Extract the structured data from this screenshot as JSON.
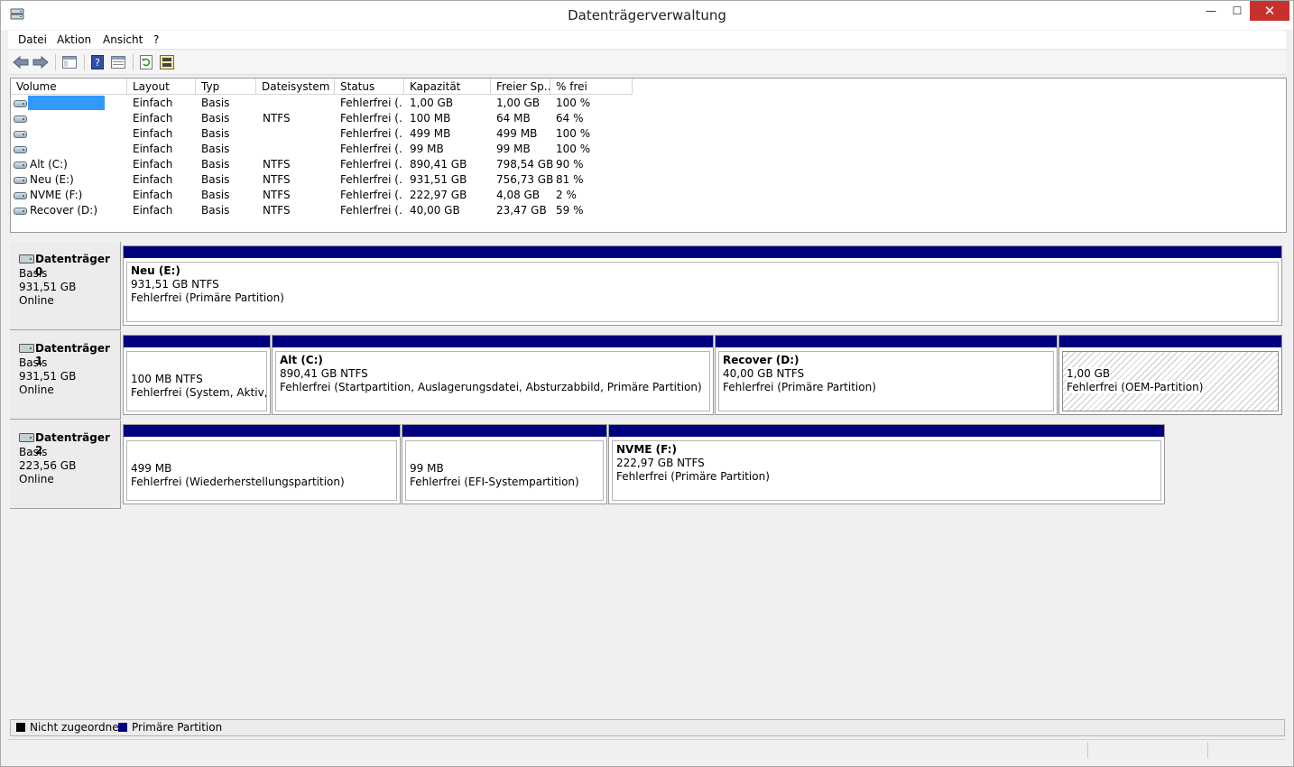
{
  "window": {
    "title": "Datenträgerverwaltung",
    "minimize": "—",
    "maximize": "☐",
    "close": "✕"
  },
  "menu": [
    "Datei",
    "Aktion",
    "Ansicht",
    "?"
  ],
  "toolbar": {
    "buttons": [
      "back-icon",
      "forward-icon",
      "console-tree-icon",
      "help-icon",
      "properties-icon",
      "refresh-icon",
      "rescan-icon"
    ]
  },
  "volume_table": {
    "columns": [
      "Volume",
      "Layout",
      "Typ",
      "Dateisystem",
      "Status",
      "Kapazität",
      "Freier Sp...",
      "% frei"
    ],
    "rows": [
      {
        "volume": "",
        "layout": "Einfach",
        "typ": "Basis",
        "fs": "",
        "status": "Fehlerfrei (...",
        "capacity": "1,00 GB",
        "free": "1,00 GB",
        "pct": "100 %",
        "selected": true
      },
      {
        "volume": "",
        "layout": "Einfach",
        "typ": "Basis",
        "fs": "NTFS",
        "status": "Fehlerfrei (...",
        "capacity": "100 MB",
        "free": "64 MB",
        "pct": "64 %"
      },
      {
        "volume": "",
        "layout": "Einfach",
        "typ": "Basis",
        "fs": "",
        "status": "Fehlerfrei (...",
        "capacity": "499 MB",
        "free": "499 MB",
        "pct": "100 %"
      },
      {
        "volume": "",
        "layout": "Einfach",
        "typ": "Basis",
        "fs": "",
        "status": "Fehlerfrei (...",
        "capacity": "99 MB",
        "free": "99 MB",
        "pct": "100 %"
      },
      {
        "volume": "Alt (C:)",
        "layout": "Einfach",
        "typ": "Basis",
        "fs": "NTFS",
        "status": "Fehlerfrei (...",
        "capacity": "890,41 GB",
        "free": "798,54 GB",
        "pct": "90 %"
      },
      {
        "volume": "Neu (E:)",
        "layout": "Einfach",
        "typ": "Basis",
        "fs": "NTFS",
        "status": "Fehlerfrei (...",
        "capacity": "931,51 GB",
        "free": "756,73 GB",
        "pct": "81 %"
      },
      {
        "volume": "NVME (F:)",
        "layout": "Einfach",
        "typ": "Basis",
        "fs": "NTFS",
        "status": "Fehlerfrei (...",
        "capacity": "222,97 GB",
        "free": "4,08 GB",
        "pct": "2 %"
      },
      {
        "volume": "Recover (D:)",
        "layout": "Einfach",
        "typ": "Basis",
        "fs": "NTFS",
        "status": "Fehlerfrei (...",
        "capacity": "40,00 GB",
        "free": "23,47 GB",
        "pct": "59 %"
      }
    ]
  },
  "disks": [
    {
      "name": "Datenträger 0",
      "type": "Basis",
      "size": "931,51 GB",
      "state": "Online",
      "partitions": [
        {
          "name": "Neu  (E:)",
          "size": "931,51 GB NTFS",
          "status": "Fehlerfrei (Primäre Partition)"
        }
      ]
    },
    {
      "name": "Datenträger 1",
      "type": "Basis",
      "size": "931,51 GB",
      "state": "Online",
      "partitions": [
        {
          "name": "",
          "size": "100 MB NTFS",
          "status": "Fehlerfrei (System, Aktiv, Pri"
        },
        {
          "name": "Alt  (C:)",
          "size": "890,41 GB NTFS",
          "status": "Fehlerfrei (Startpartition, Auslagerungsdatei, Absturzabbild, Primäre Partition)"
        },
        {
          "name": "Recover  (D:)",
          "size": "40,00 GB NTFS",
          "status": "Fehlerfrei (Primäre Partition)"
        },
        {
          "name": "",
          "size": "1,00 GB",
          "status": "Fehlerfrei (OEM-Partition)",
          "selected": true
        }
      ]
    },
    {
      "name": "Datenträger 2",
      "type": "Basis",
      "size": "223,56 GB",
      "state": "Online",
      "partitions": [
        {
          "name": "",
          "size": "499 MB",
          "status": "Fehlerfrei (Wiederherstellungspartition)"
        },
        {
          "name": "",
          "size": "99 MB",
          "status": "Fehlerfrei (EFI-Systempartition)"
        },
        {
          "name": "NVME  (F:)",
          "size": "222,97 GB NTFS",
          "status": "Fehlerfrei (Primäre Partition)"
        }
      ]
    }
  ],
  "legend": [
    {
      "label": "Nicht zugeordnet",
      "color": "#000000"
    },
    {
      "label": "Primäre Partition",
      "color": "#00007e"
    }
  ]
}
